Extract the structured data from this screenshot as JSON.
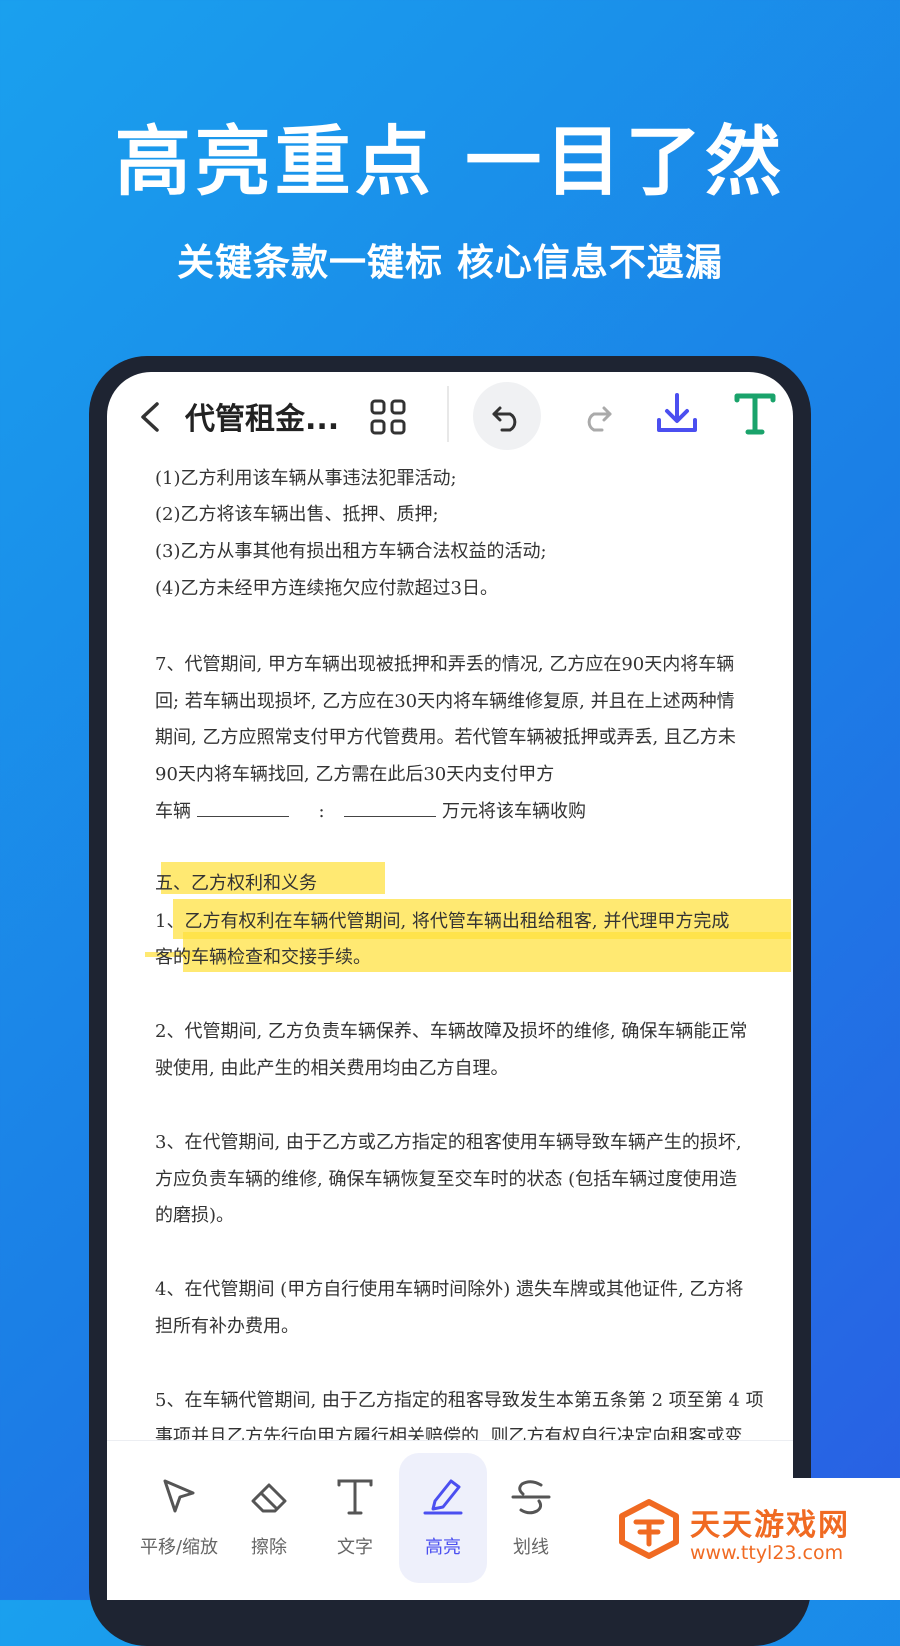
{
  "promo": {
    "headline": "高亮重点 一目了然",
    "subline": "关键条款一键标 核心信息不遗漏"
  },
  "topbar": {
    "title": "代管租金...",
    "icons": [
      "back-icon",
      "grid-icon",
      "undo-icon",
      "redo-icon",
      "download-icon",
      "text-tool-icon"
    ]
  },
  "document": {
    "l1": "(1)乙方利用该车辆从事违法犯罪活动;",
    "l2": "(2)乙方将该车辆出售、抵押、质押;",
    "l3": "(3)乙方从事其他有损出租方车辆合法权益的活动;",
    "l4": "(4)乙方未经甲方连续拖欠应付款超过3日。",
    "p7a": "7、代管期间, 甲方车辆出现被抵押和弄丢的情况, 乙方应在90天内将车辆",
    "p7b": "回; 若车辆出现损坏, 乙方应在30天内将车辆维修复原, 并且在上述两种情",
    "p7c": "期间, 乙方应照常支付甲方代管费用。若代管车辆被抵押或弄丢, 且乙方未",
    "p7d": "90天内将车辆找回, 乙方需在此后30天内支付甲方",
    "p7e_a": "车辆",
    "p7e_b": ":",
    "p7e_c": "万元将该车辆收购",
    "sec5": "五、乙方权利和义务",
    "s1a": "1、乙方有权利在车辆代管期间, 将代管车辆出租给租客, 并代理甲方完成",
    "s1b": "客的车辆检查和交接手续。",
    "s2a": "2、代管期间, 乙方负责车辆保养、车辆故障及损坏的维修, 确保车辆能正常",
    "s2b": "驶使用, 由此产生的相关费用均由乙方自理。",
    "s3a": "3、在代管期间, 由于乙方或乙方指定的租客使用车辆导致车辆产生的损坏,",
    "s3b": "方应负责车辆的维修, 确保车辆恢复至交车时的状态 (包括车辆过度使用造",
    "s3c": "的磨损)。",
    "s4a": "4、在代管期间 (甲方自行使用车辆时间除外) 遗失车牌或其他证件, 乙方将",
    "s4b": "担所有补办费用。",
    "s5a": "5、在车辆代管期间, 由于乙方指定的租客导致发生本第五条第 2 项至第 4 项",
    "s5b": "事项并且乙方先行向甲方履行相关赔偿的, 则乙方有权自行决定向租客或变"
  },
  "toolbar": {
    "pan": "平移/缩放",
    "erase": "擦除",
    "text": "文字",
    "highlight": "高亮",
    "strike": "划线",
    "active": "highlight"
  },
  "watermark": {
    "name": "天天游戏网",
    "url": "www.ttyl23.com"
  },
  "colors": {
    "accent": "#4b4ff0",
    "download": "#4b4ff0",
    "text_tool": "#1aa36b",
    "highlight": "#ffe13c",
    "watermark": "#f06a22"
  }
}
